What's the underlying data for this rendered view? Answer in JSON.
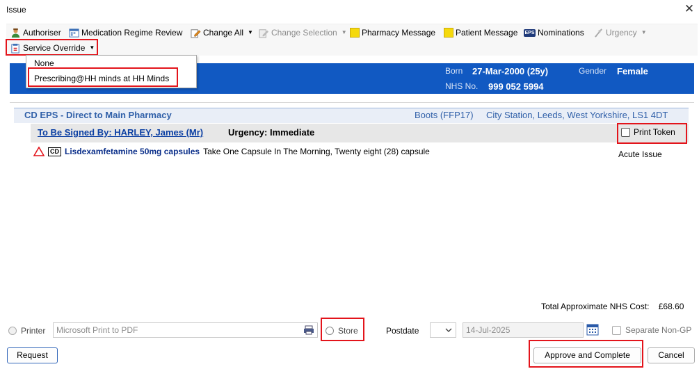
{
  "window": {
    "title": "Issue",
    "close_glyph": "✕"
  },
  "toolbar": {
    "authoriser": "Authoriser",
    "regime_review": "Medication Regime Review",
    "change_all": "Change All",
    "change_selection": "Change Selection",
    "pharmacy_message": "Pharmacy Message",
    "patient_message": "Patient Message",
    "eps_badge": "EPS",
    "nominations": "Nominations",
    "urgency": "Urgency",
    "service_override": "Service Override"
  },
  "service_override_menu": {
    "items": [
      "None",
      "Prescribing@HH minds at HH Minds"
    ]
  },
  "patient": {
    "born_label": "Born",
    "born_value": "27-Mar-2000 (25y)",
    "gender_label": "Gender",
    "gender_value": "Female",
    "nhs_label": "NHS No.",
    "nhs_value": "999 052 5994"
  },
  "prescription": {
    "route": "CD EPS - Direct to Main Pharmacy",
    "pharmacy": "Boots (FFP17)",
    "address": "City Station, Leeds, West Yorkshire, LS1 4DT",
    "signer": "To Be Signed By: HARLEY, James (Mr)",
    "urgency": "Urgency: Immediate",
    "print_token": "Print Token",
    "cd_badge": "CD",
    "medication_name": "Lisdexamfetamine 50mg capsules",
    "dosage": "Take One Capsule In The Morning, Twenty eight (28) capsule",
    "issue_type": "Acute Issue"
  },
  "totals": {
    "label": "Total Approximate NHS Cost:",
    "value": "£68.60"
  },
  "output": {
    "printer_label": "Printer",
    "printer_value": "Microsoft Print to PDF",
    "store_label": "Store",
    "postdate_label": "Postdate",
    "postdate_value": "14-Jul-2025",
    "separate_label": "Separate Non-GP"
  },
  "buttons": {
    "request": "Request",
    "approve": "Approve and Complete",
    "cancel": "Cancel"
  },
  "colors": {
    "banner": "#1159c2",
    "highlight": "#e3141b",
    "link": "#0b3fa3"
  }
}
